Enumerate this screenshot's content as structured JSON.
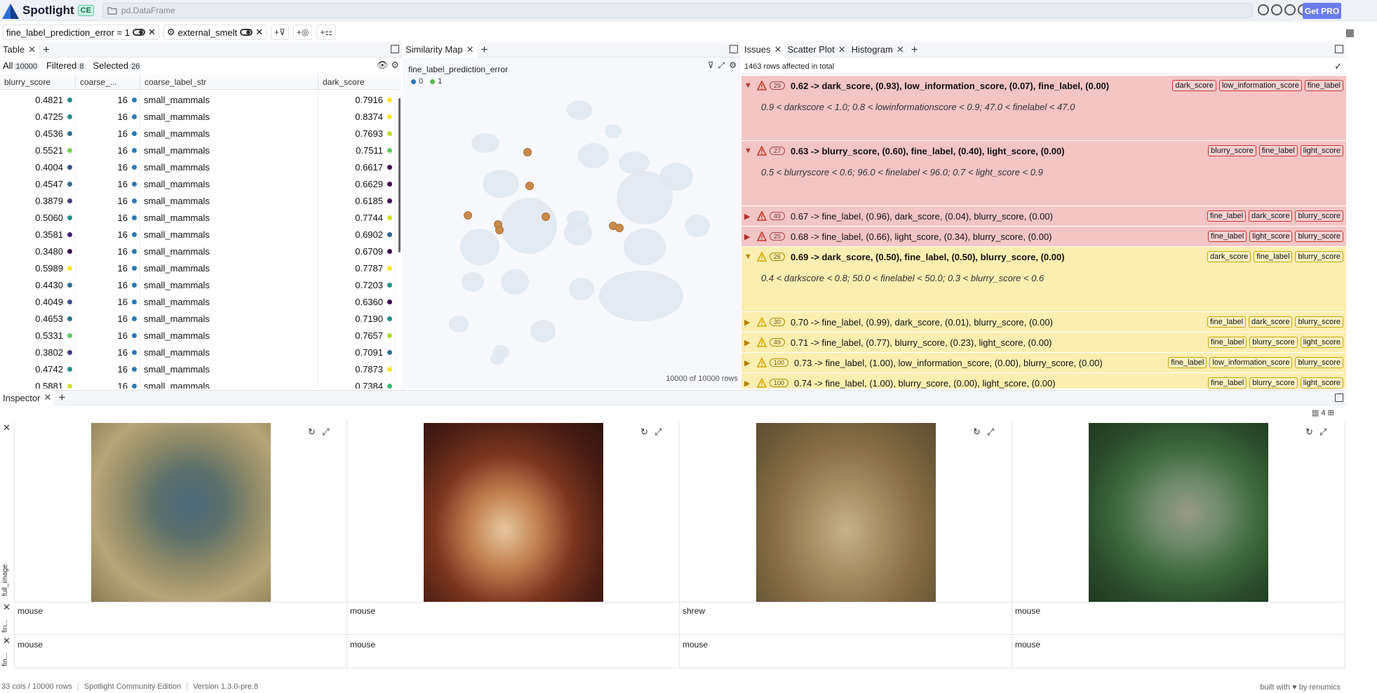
{
  "app": {
    "name": "Spotlight",
    "edition_badge": "CE",
    "dataset_path": "pd.DataFrame",
    "get_pro_label": "Get PRO"
  },
  "filters": [
    {
      "label": "fine_label_prediction_error = 1"
    },
    {
      "label": "external_smelt"
    }
  ],
  "table": {
    "tab_label": "Table",
    "all_label": "All",
    "all_count": "10000",
    "filtered_label": "Filtered",
    "filtered_count": "8",
    "selected_label": "Selected",
    "selected_count": "26",
    "columns": [
      "blurry_score",
      "coarse_...",
      "coarse_label_str",
      "dark_score"
    ],
    "rows": [
      {
        "blurry": "0.4821",
        "bc": "#21918c",
        "coarse": "16",
        "str": "small_mammals",
        "dark": "0.7916",
        "dc": "#fde725"
      },
      {
        "blurry": "0.4725",
        "bc": "#21918c",
        "coarse": "16",
        "str": "small_mammals",
        "dark": "0.8374",
        "dc": "#fde725"
      },
      {
        "blurry": "0.4536",
        "bc": "#2c728e",
        "coarse": "16",
        "str": "small_mammals",
        "dark": "0.7693",
        "dc": "#bddf26"
      },
      {
        "blurry": "0.5521",
        "bc": "#7ad151",
        "coarse": "16",
        "str": "small_mammals",
        "dark": "0.7511",
        "dc": "#5ec962"
      },
      {
        "blurry": "0.4004",
        "bc": "#3b528b",
        "coarse": "16",
        "str": "small_mammals",
        "dark": "0.6617",
        "dc": "#440154"
      },
      {
        "blurry": "0.4547",
        "bc": "#2c728e",
        "coarse": "16",
        "str": "small_mammals",
        "dark": "0.6629",
        "dc": "#440154"
      },
      {
        "blurry": "0.3879",
        "bc": "#433e85",
        "coarse": "16",
        "str": "small_mammals",
        "dark": "0.6185",
        "dc": "#440154"
      },
      {
        "blurry": "0.5060",
        "bc": "#21918c",
        "coarse": "16",
        "str": "small_mammals",
        "dark": "0.7744",
        "dc": "#d2e21b"
      },
      {
        "blurry": "0.3581",
        "bc": "#481f70",
        "coarse": "16",
        "str": "small_mammals",
        "dark": "0.6902",
        "dc": "#31688e"
      },
      {
        "blurry": "0.3480",
        "bc": "#440154",
        "coarse": "16",
        "str": "small_mammals",
        "dark": "0.6709",
        "dc": "#440154"
      },
      {
        "blurry": "0.5989",
        "bc": "#fde725",
        "coarse": "16",
        "str": "small_mammals",
        "dark": "0.7787",
        "dc": "#fde725"
      },
      {
        "blurry": "0.4430",
        "bc": "#2c728e",
        "coarse": "16",
        "str": "small_mammals",
        "dark": "0.7203",
        "dc": "#21918c"
      },
      {
        "blurry": "0.4049",
        "bc": "#3b528b",
        "coarse": "16",
        "str": "small_mammals",
        "dark": "0.6360",
        "dc": "#440154"
      },
      {
        "blurry": "0.4653",
        "bc": "#2c728e",
        "coarse": "16",
        "str": "small_mammals",
        "dark": "0.7190",
        "dc": "#21918c"
      },
      {
        "blurry": "0.5331",
        "bc": "#5ec962",
        "coarse": "16",
        "str": "small_mammals",
        "dark": "0.7657",
        "dc": "#addc30"
      },
      {
        "blurry": "0.3802",
        "bc": "#433e85",
        "coarse": "16",
        "str": "small_mammals",
        "dark": "0.7091",
        "dc": "#2c728e"
      },
      {
        "blurry": "0.4742",
        "bc": "#21918c",
        "coarse": "16",
        "str": "small_mammals",
        "dark": "0.7873",
        "dc": "#fde725"
      },
      {
        "blurry": "0.5881",
        "bc": "#d2e21b",
        "coarse": "16",
        "str": "small_mammals",
        "dark": "0.7384",
        "dc": "#3cbb75"
      }
    ]
  },
  "similarity_map": {
    "tab_label": "Similarity Map",
    "color_by": "fine_label_prediction_error",
    "legend": [
      {
        "label": "0",
        "color": "#2a78b9"
      },
      {
        "label": "1",
        "color": "#56b84a"
      }
    ],
    "footer": "10000 of 10000 rows"
  },
  "issues": {
    "tabs": [
      "Issues",
      "Scatter Plot",
      "Histogram"
    ],
    "summary": "1463 rows affected in total",
    "items": [
      {
        "sev": "red",
        "count": "29",
        "title": "0.62 -> dark_score, (0.93), low_information_score, (0.07), fine_label, (0.00)",
        "tags": [
          "dark_score",
          "low_information_score",
          "fine_label"
        ],
        "desc": "0.9 < darkscore < 1.0; 0.8 < lowinformationscore < 0.9; 47.0 < finelabel < 47.0"
      },
      {
        "sev": "red",
        "count": "27",
        "title": "0.63 -> blurry_score, (0.60), fine_label, (0.40), light_score, (0.00)",
        "tags": [
          "blurry_score",
          "fine_label",
          "light_score"
        ],
        "desc": "0.5 < blurryscore < 0.6; 96.0 < finelabel < 96.0; 0.7 < light_score < 0.9"
      },
      {
        "sev": "red",
        "count": "49",
        "title": "0.67 -> fine_label, (0.96), dark_score, (0.04), blurry_score, (0.00)",
        "tags": [
          "fine_label",
          "dark_score",
          "blurry_score"
        ],
        "desc": ""
      },
      {
        "sev": "red",
        "count": "25",
        "title": "0.68 -> fine_label, (0.66), light_score, (0.34), blurry_score, (0.00)",
        "tags": [
          "fine_label",
          "light_score",
          "blurry_score"
        ],
        "desc": ""
      },
      {
        "sev": "yel",
        "count": "26",
        "title": "0.69 -> dark_score, (0.50), fine_label, (0.50), blurry_score, (0.00)",
        "tags": [
          "dark_score",
          "fine_label",
          "blurry_score"
        ],
        "desc": "0.4 < darkscore < 0.8; 50.0 < finelabel < 50.0; 0.3 < blurry_score < 0.6"
      },
      {
        "sev": "yel",
        "count": "30",
        "title": "0.70 -> fine_label, (0.99), dark_score, (0.01), blurry_score, (0.00)",
        "tags": [
          "fine_label",
          "dark_score",
          "blurry_score"
        ],
        "desc": ""
      },
      {
        "sev": "yel",
        "count": "49",
        "title": "0.71 -> fine_label, (0.77), blurry_score, (0.23), light_score, (0.00)",
        "tags": [
          "fine_label",
          "blurry_score",
          "light_score"
        ],
        "desc": ""
      },
      {
        "sev": "yel",
        "count": "100",
        "title": "0.73 -> fine_label, (1.00), low_information_score, (0.00), blurry_score, (0.00)",
        "tags": [
          "fine_label",
          "low_information_score",
          "blurry_score"
        ],
        "desc": ""
      },
      {
        "sev": "yel",
        "count": "100",
        "title": "0.74 -> fine_label, (1.00), blurry_score, (0.00), light_score, (0.00)",
        "tags": [
          "fine_label",
          "blurry_score",
          "light_score"
        ],
        "desc": ""
      }
    ]
  },
  "inspector": {
    "tab_label": "Inspector",
    "columns_count": "4",
    "row_labels": [
      "full_image",
      "fin...",
      "fin..."
    ],
    "cards": [
      {
        "fine_label": "mouse",
        "prediction": "mouse"
      },
      {
        "fine_label": "mouse",
        "prediction": "mouse"
      },
      {
        "fine_label": "shrew",
        "prediction": "mouse"
      },
      {
        "fine_label": "mouse",
        "prediction": "mouse"
      }
    ]
  },
  "footer": {
    "cols_rows": "33 cols / 10000 rows",
    "edition": "Spotlight Community Edition",
    "version": "Version 1.3.0-pre.8",
    "built_with": "built with ♥ by renumics"
  }
}
